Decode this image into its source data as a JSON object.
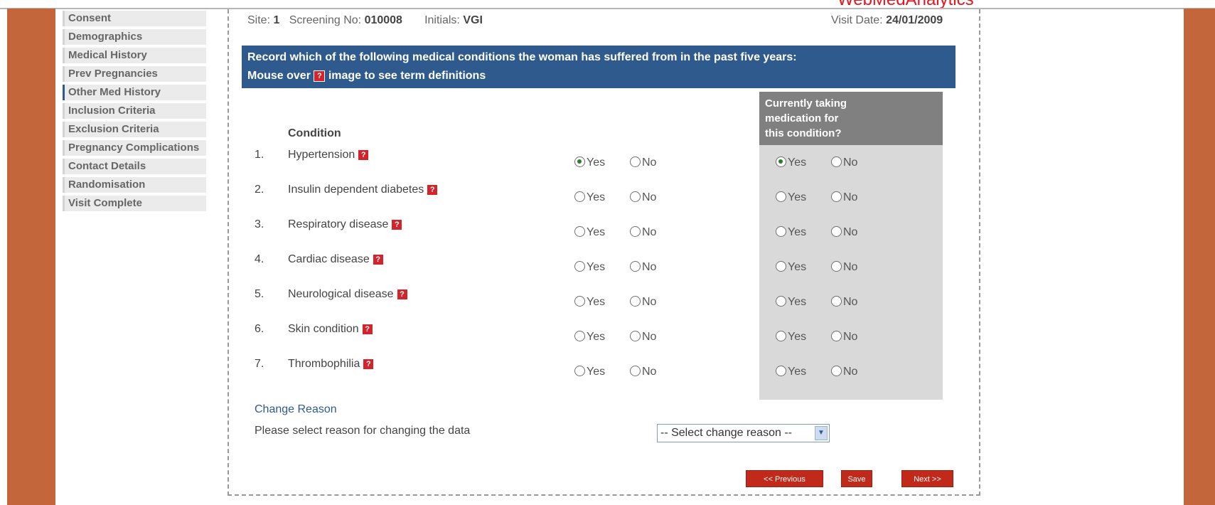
{
  "watermark": "WebMedAnalytics",
  "sidebar": {
    "items": [
      {
        "label": "Consent"
      },
      {
        "label": "Demographics"
      },
      {
        "label": "Medical History"
      },
      {
        "label": "Prev Pregnancies"
      },
      {
        "label": "Other Med History"
      },
      {
        "label": "Inclusion Criteria"
      },
      {
        "label": "Exclusion Criteria"
      },
      {
        "label": "Pregnancy Complications"
      },
      {
        "label": "Contact Details"
      },
      {
        "label": "Randomisation"
      },
      {
        "label": "Visit Complete"
      }
    ]
  },
  "header": {
    "site_label": "Site:",
    "site_value": "1",
    "screening_label": "Screening No:",
    "screening_value": "010008",
    "initials_label": "Initials:",
    "initials_value": "VGI",
    "visit_label": "Visit Date:",
    "visit_value": "24/01/2009"
  },
  "banner": {
    "line1": "Record which of the following medical conditions the woman has suffered from in the past five years:",
    "line2_prefix": "Mouse over",
    "line2_suffix": "image to see term definitions"
  },
  "table": {
    "condition_header": "Condition",
    "medication_header_1": "Currently taking",
    "medication_header_2": "medication for",
    "medication_header_3": "this condition?",
    "yes_label": "Yes",
    "no_label": "No",
    "help_glyph": "?",
    "rows": [
      {
        "num": "1.",
        "condition": "Hypertension",
        "suffered": "Yes",
        "medication": "Yes"
      },
      {
        "num": "2.",
        "condition": "Insulin dependent diabetes",
        "suffered": "",
        "medication": ""
      },
      {
        "num": "3.",
        "condition": "Respiratory disease",
        "suffered": "",
        "medication": ""
      },
      {
        "num": "4.",
        "condition": "Cardiac disease",
        "suffered": "",
        "medication": ""
      },
      {
        "num": "5.",
        "condition": "Neurological disease",
        "suffered": "",
        "medication": ""
      },
      {
        "num": "6.",
        "condition": "Skin condition",
        "suffered": "",
        "medication": ""
      },
      {
        "num": "7.",
        "condition": "Thrombophilia",
        "suffered": "",
        "medication": ""
      }
    ]
  },
  "change": {
    "title": "Change Reason",
    "note": "Please select reason for changing the data",
    "select_value": "-- Select change reason --"
  },
  "buttons": {
    "previous": "<< Previous",
    "save": "Save",
    "next": "Next >>"
  },
  "colors": {
    "brand": "#c4663c",
    "banner": "#2f5a8e",
    "button": "#c12a1a",
    "medication_header": "#808080",
    "medication_column": "#d9d9d9"
  }
}
